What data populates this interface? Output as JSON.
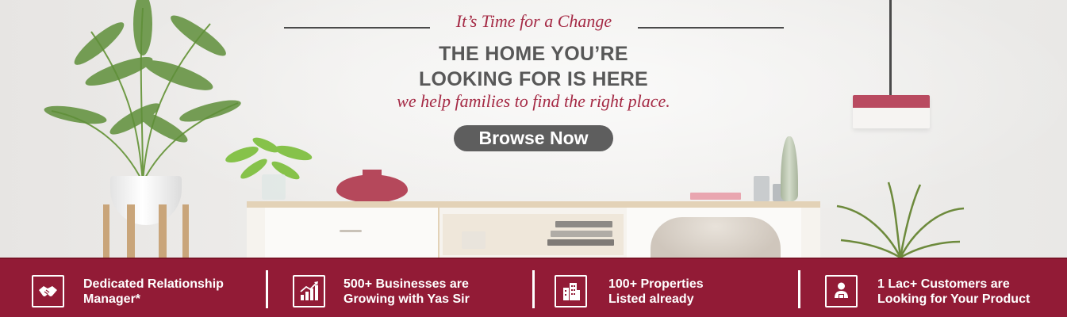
{
  "hero": {
    "kicker": "It’s Time for a Change",
    "headline_line1": "THE HOME YOU’RE",
    "headline_line2": "LOOKING FOR IS HERE",
    "tagline": "we help families to find the right place.",
    "browse_label": "Browse Now"
  },
  "stats": [
    {
      "icon": "handshake-icon",
      "line1": "Dedicated Relationship",
      "line2": "Manager*"
    },
    {
      "icon": "growth-chart-icon",
      "line1": "500+ Businesses are",
      "line2": "Growing with Yas Sir"
    },
    {
      "icon": "buildings-icon",
      "line1": "100+ Properties",
      "line2": "Listed already"
    },
    {
      "icon": "customer-icon",
      "line1": "1 Lac+ Customers are",
      "line2": "Looking for Your Product"
    }
  ],
  "colors": {
    "brand_red": "#921b36",
    "accent_text": "#a52a45",
    "button_gray": "#5e5e5e",
    "headline_gray": "#585858"
  }
}
